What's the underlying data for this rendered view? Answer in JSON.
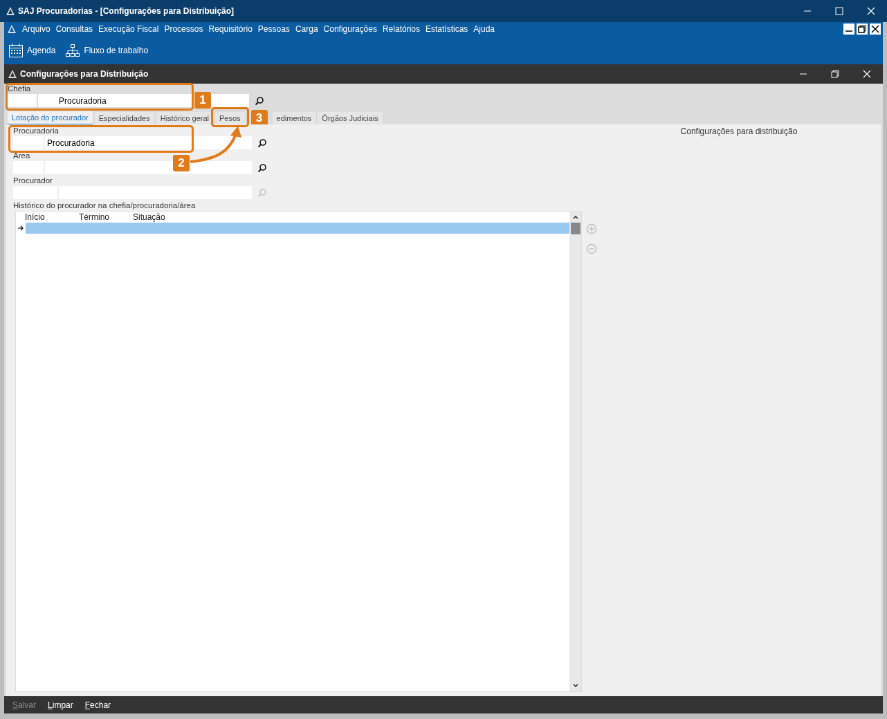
{
  "window": {
    "title": "SAJ Procuradorias - [Configurações para Distribuição]"
  },
  "menu": [
    "Arquivo",
    "Consultas",
    "Execução Fiscal",
    "Processos",
    "Requisitório",
    "Pessoas",
    "Carga",
    "Configurações",
    "Relatórios",
    "Estatísticas",
    "Ajuda"
  ],
  "toolbar": [
    {
      "label": "Agenda",
      "kind": "calendar"
    },
    {
      "label": "Fluxo de trabalho",
      "kind": "flow"
    }
  ],
  "child_window": {
    "title": "Configurações para Distribuição"
  },
  "chefia": {
    "label": "Chefia",
    "value": "Procuradoria"
  },
  "tabs": [
    {
      "label": "Lotação do procurador",
      "selected": true
    },
    {
      "label": "Especialidades",
      "selected": false
    },
    {
      "label": "Histórico geral",
      "selected": false
    },
    {
      "label": "Pesos",
      "selected": false
    },
    {
      "label": "edimentos",
      "selected": false
    },
    {
      "label": "Órgãos Judiciais",
      "selected": false
    }
  ],
  "fields": [
    {
      "label": "Procuradoria",
      "value": "Procuradoria",
      "disabled": false
    },
    {
      "label": "Área",
      "disabled": false
    },
    {
      "label": "Procurador",
      "disabled": true
    }
  ],
  "history": {
    "label": "Histórico do procurador na chefia/procuradoria/área",
    "columns": [
      "Início",
      "Término",
      "Situação"
    ],
    "rows": [
      {
        "selected": true
      }
    ]
  },
  "side_title": "Configurações para distribuição",
  "footer": [
    {
      "label": "Salvar",
      "disabled": true
    },
    {
      "label": "Limpar",
      "disabled": false
    },
    {
      "label": "Fechar",
      "disabled": false
    }
  ],
  "callouts": [
    {
      "number": "1"
    },
    {
      "number": "2"
    },
    {
      "number": "3"
    }
  ]
}
